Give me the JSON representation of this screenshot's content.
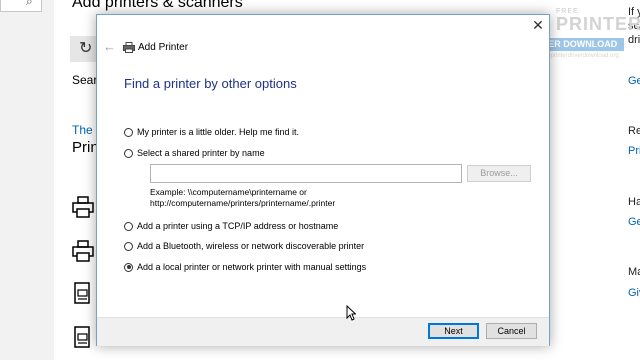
{
  "background": {
    "heading": "Add printers & scanners",
    "search_label": "Searc",
    "link_partial": "The p",
    "printers_heading": "Prin",
    "search_glyph": "⌕",
    "refresh_glyph": "↻",
    "right_column": [
      "If y",
      "scan",
      "driv",
      "Ge",
      "Re",
      "Pri",
      "Ha",
      "Ge",
      "Ma",
      "Giv"
    ]
  },
  "watermark": {
    "free": "FREE",
    "printer": "PRINTER",
    "band": "DRIVER DOWNLOAD",
    "site": "www.freeprinterdriverdownload.org"
  },
  "dialog": {
    "title": "Add Printer",
    "heading": "Find a printer by other options",
    "close_glyph": "✕",
    "back_glyph": "←",
    "options": [
      {
        "label": "My printer is a little older. Help me find it.",
        "selected": false
      },
      {
        "label": "Select a shared printer by name",
        "selected": false
      },
      {
        "label": "Add a printer using a TCP/IP address or hostname",
        "selected": false
      },
      {
        "label": "Add a Bluetooth, wireless or network discoverable printer",
        "selected": false
      },
      {
        "label": "Add a local printer or network printer with manual settings",
        "selected": true
      }
    ],
    "shared_input_value": "",
    "browse_label": "Browse...",
    "example_line1": "Example: \\\\computername\\printername or",
    "example_line2": "http://computername/printers/printername/.printer",
    "next_label": "Next",
    "cancel_label": "Cancel"
  },
  "colors": {
    "accent": "#0078d7",
    "heading_blue": "#1e3287",
    "link_blue": "#0063b1"
  }
}
